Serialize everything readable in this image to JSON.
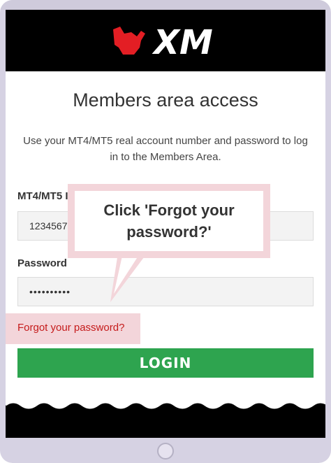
{
  "brand": {
    "name": "XM",
    "accent": "#e31e24"
  },
  "page": {
    "title": "Members area access",
    "description": "Use your MT4/MT5 real account number and password to log in to the Members Area."
  },
  "form": {
    "account_label": "MT4/MT5 I",
    "account_value": "12345678",
    "password_label": "Password",
    "password_value": "••••••••••",
    "forgot_link": "Forgot your password?",
    "login_button": "LOGIN",
    "button_color": "#2ea44f"
  },
  "callout": {
    "line1": "Click 'Forgot your",
    "line2": "password?'"
  }
}
